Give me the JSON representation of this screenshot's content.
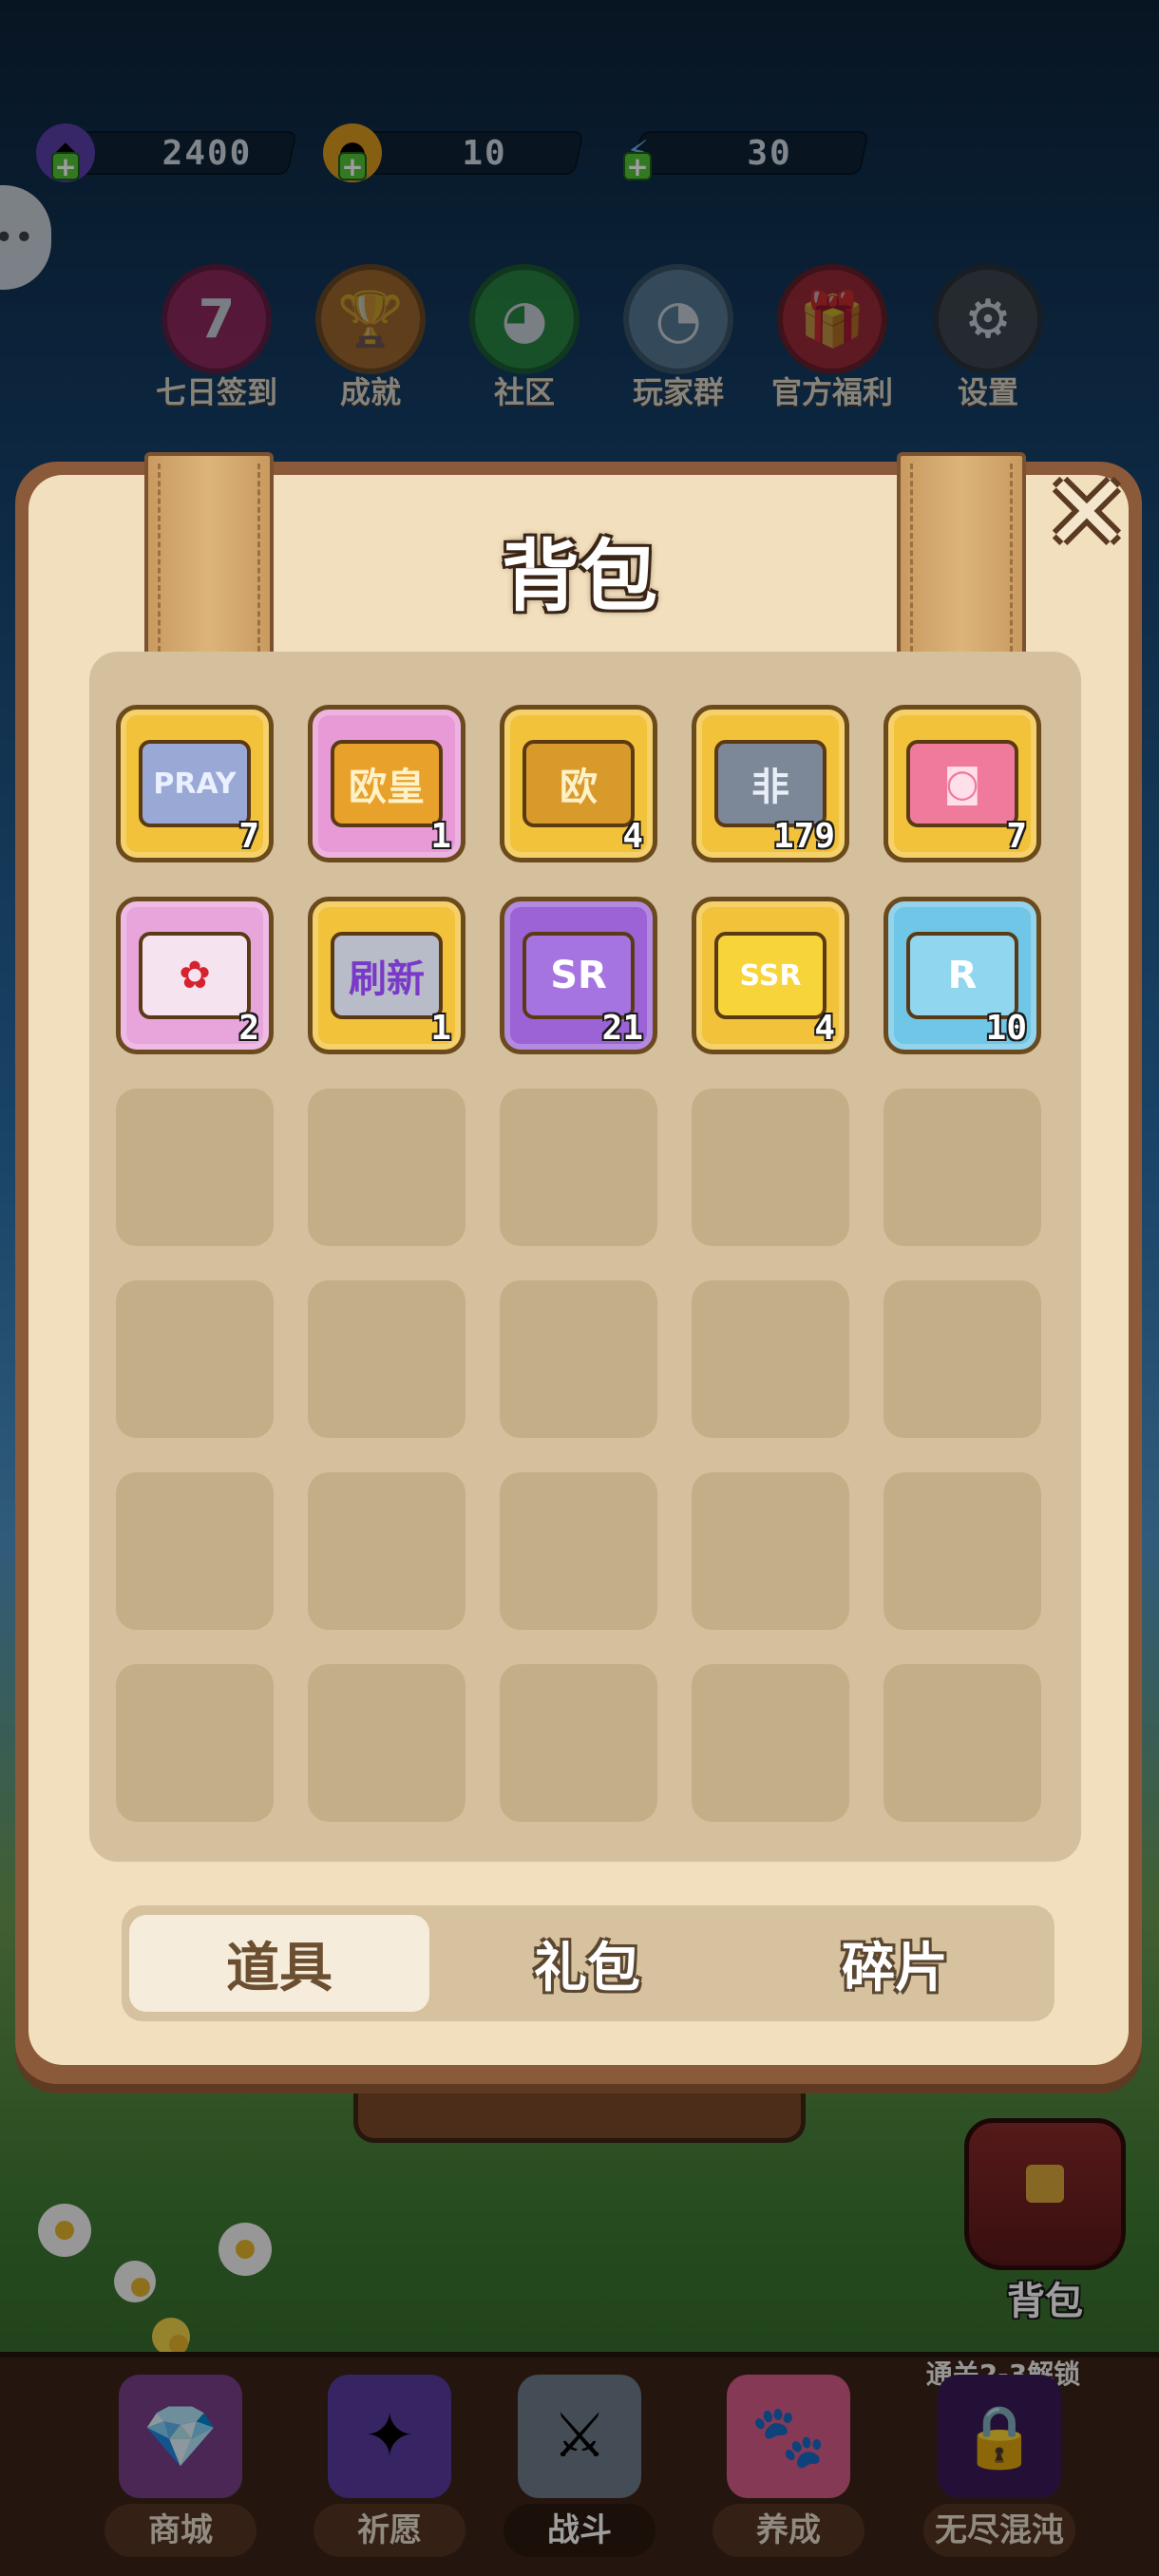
{
  "currencies": [
    {
      "name": "gem",
      "icon": "gem-icon",
      "value": "2400"
    },
    {
      "name": "coin",
      "icon": "coin-icon",
      "value": "10"
    },
    {
      "name": "energy",
      "icon": "lightning-icon",
      "value": "30"
    }
  ],
  "features": [
    {
      "label": "七日签到",
      "icon": "calendar-seven-icon",
      "glyph": "7",
      "color": "#b5245c"
    },
    {
      "label": "成就",
      "icon": "trophy-icon",
      "glyph": "🏆",
      "color": "#c8751e"
    },
    {
      "label": "社区",
      "icon": "chat-bubble-icon",
      "glyph": "◕",
      "color": "#2f9a3a"
    },
    {
      "label": "玩家群",
      "icon": "penguin-icon",
      "glyph": "◔",
      "color": "#6c8ea6"
    },
    {
      "label": "官方福利",
      "icon": "gift-icon",
      "glyph": "🎁",
      "color": "#c4262c"
    },
    {
      "label": "设置",
      "icon": "gear-icon",
      "glyph": "⚙",
      "color": "#4a4a4a"
    }
  ],
  "modal": {
    "title": "背包",
    "close_label": "✕"
  },
  "items": [
    {
      "name": "pray-ticket",
      "glyph_text": "PRAY",
      "qty": "7",
      "bg": "#f2c23a",
      "glyph_bg": "#9aa8d6",
      "glyph_color": "#eaf0ff"
    },
    {
      "name": "ouhuang-ticket",
      "glyph_text": "欧皇",
      "qty": "1",
      "bg": "#e79ad6",
      "glyph_bg": "#e8a12a",
      "glyph_color": "#fff1c8"
    },
    {
      "name": "ou-ticket-fragment",
      "glyph_text": "欧",
      "qty": "4",
      "bg": "#f2c23a",
      "glyph_bg": "#d99a2c",
      "glyph_color": "#fff1c8"
    },
    {
      "name": "fei-ticket-fragment",
      "glyph_text": "非",
      "qty": "179",
      "bg": "#f2c23a",
      "glyph_bg": "#7c8798",
      "glyph_color": "#e9eef6"
    },
    {
      "name": "pink-ticket",
      "glyph_text": "◙",
      "qty": "7",
      "bg": "#f2c23a",
      "glyph_bg": "#f07a9c",
      "glyph_color": "#ffe0ea"
    },
    {
      "name": "sakura-flower",
      "glyph_text": "✿",
      "qty": "2",
      "bg": "#e8a5dc",
      "glyph_bg": "#f6e3f0",
      "glyph_color": "#d4222e"
    },
    {
      "name": "refresh-ticket",
      "glyph_text": "刷新",
      "qty": "1",
      "bg": "#f2c23a",
      "glyph_bg": "#b8bcc8",
      "glyph_color": "#7a3ac8"
    },
    {
      "name": "sr-fragment",
      "glyph_text": "SR",
      "qty": "21",
      "bg": "#9b63d6",
      "glyph_bg": "#a574e0",
      "glyph_color": "#ffffff"
    },
    {
      "name": "ssr-fragment",
      "glyph_text": "SSR",
      "qty": "4",
      "bg": "#f2c23a",
      "glyph_bg": "#f7d43a",
      "glyph_color": "#ffffff"
    },
    {
      "name": "r-fragment",
      "glyph_text": "R",
      "qty": "10",
      "bg": "#6fc6e6",
      "glyph_bg": "#8fd6ee",
      "glyph_color": "#ffffff"
    }
  ],
  "tabs": [
    {
      "label": "道具",
      "active": true
    },
    {
      "label": "礼包",
      "active": false
    },
    {
      "label": "碎片",
      "active": false
    }
  ],
  "side_bag": {
    "label": "背包",
    "icon": "backpack-icon"
  },
  "bottom_nav": {
    "lock_note": "通关2-3解锁",
    "items": [
      {
        "label": "商城",
        "icon": "shop-gems-icon",
        "glyph": "💎",
        "color": "#7a3f8a",
        "active": false
      },
      {
        "label": "祈愿",
        "icon": "wish-card-icon",
        "glyph": "✦",
        "color": "#5a3aa0",
        "active": false
      },
      {
        "label": "战斗",
        "icon": "crossed-swords-icon",
        "glyph": "⚔",
        "color": "#6f7b8a",
        "active": true
      },
      {
        "label": "养成",
        "icon": "paw-icon",
        "glyph": "🐾",
        "color": "#d85c8a",
        "active": false
      },
      {
        "label": "无尽混沌",
        "icon": "lock-icon",
        "glyph": "🔒",
        "color": "#3a1a5a",
        "active": false
      }
    ]
  }
}
